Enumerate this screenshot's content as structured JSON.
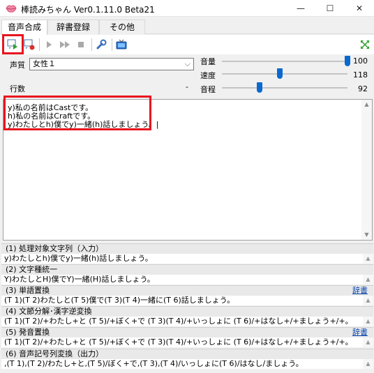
{
  "window": {
    "title": "棒読みちゃん Ver0.1.11.0 Beta21",
    "minimize": "—",
    "maximize": "☐",
    "close": "✕"
  },
  "tabs": [
    {
      "label": "音声合成"
    },
    {
      "label": "辞書登録"
    },
    {
      "label": "その他"
    }
  ],
  "toolbar": {
    "icons": [
      "speak-selected-icon",
      "stop-speak-icon",
      "play-icon",
      "fast-forward-icon",
      "stop-icon",
      "wrench-icon",
      "tv-icon",
      "expand-icon"
    ]
  },
  "controls": {
    "voice_label": "声質",
    "voice_value": "女性１",
    "lines_label": "行数",
    "lines_value": "-",
    "volume_label": "音量",
    "volume_value": "100",
    "volume_level": 1.0,
    "speed_label": "速度",
    "speed_value": "118",
    "speed_level": 0.46,
    "pitch_label": "音程",
    "pitch_value": "92",
    "pitch_level": 0.3
  },
  "editor": {
    "text": "y)私の名前はCastです。\nh)私の名前はCraftです。\ny)わたしとh)僕でy)一緒(h)話しましょう。|"
  },
  "sections": [
    {
      "head": "(1) 処理対象文字列（入力）",
      "line": "y)わたしとh)僕でy)一緒(h)話しましょう。",
      "link": ""
    },
    {
      "head": "(2) 文字種統一",
      "line": "Y)わたしとH)僕でY)一緒(H)話しましょう。",
      "link": ""
    },
    {
      "head": "(3) 単語置換",
      "line": "(T 1)(T 2)わたしと(T 5)僕で(T 3)(T 4)一緒に(T 6)話しましょう。",
      "link": "辞書"
    },
    {
      "head": "(4) 文節分解･漢字逆変換",
      "line": "(T 1)(T 2)/+わたし+と (T 5)/+ぼく+で (T 3)(T 4)/+いっしょに (T 6)/+はなし+/+ましょう+/+。",
      "link": ""
    },
    {
      "head": "(5) 発音置換",
      "line": "(T 1)(T 2)/+わたし+と (T 5)/+ぼく+で (T 3)(T 4)/+いっしょに (T 6)/+はなし+/+ましょう+/+。",
      "link": "辞書"
    },
    {
      "head": "(6) 音声記号列変換（出力）",
      "line": ",(T 1),(T 2)/わたし+と,(T 5)/ぼく+で,(T 3),(T 4)/いっしょに(T 6)/はなし/ましょう。",
      "link": ""
    }
  ]
}
